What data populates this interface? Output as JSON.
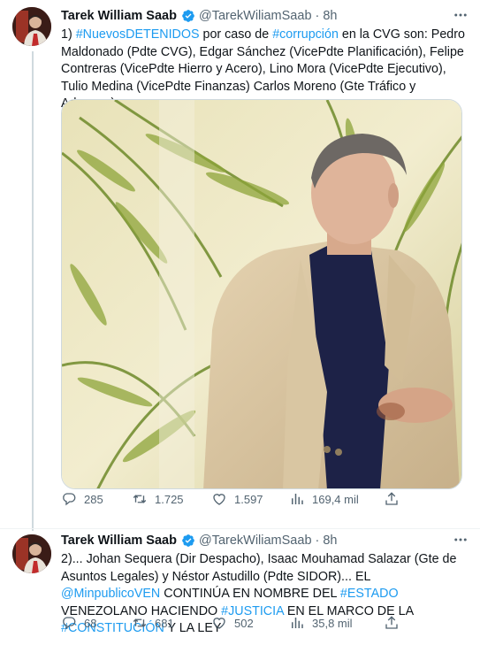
{
  "tweets": [
    {
      "author": {
        "name": "Tarek William Saab",
        "handle": "@TarekWiliamSaab",
        "verified": true
      },
      "time": "8h",
      "text_parts": [
        {
          "t": "1) ",
          "tag": false
        },
        {
          "t": "#NuevosDETENIDOS",
          "tag": true
        },
        {
          "t": " por caso de ",
          "tag": false
        },
        {
          "t": "#corrupción",
          "tag": true
        },
        {
          "t": " en la CVG son: Pedro Maldonado (Pdte CVG), Edgar Sánchez (VicePdte Planificación), Felipe Contreras (VicePdte Hierro y Acero), Lino Mora (VicePdte Ejecutivo), Tulio Medina (VicePdte Finanzas) Carlos Moreno (Gte Tráfico y Aduanas)",
          "tag": false
        }
      ],
      "stats": {
        "replies": "285",
        "retweets": "1.725",
        "likes": "1.597",
        "views": "169,4 mil"
      }
    },
    {
      "author": {
        "name": "Tarek William Saab",
        "handle": "@TarekWiliamSaab",
        "verified": true
      },
      "time": "8h",
      "text_parts": [
        {
          "t": "2)... Johan Sequera (Dir Despacho), Isaac Mouhamad Salazar (Gte de Asuntos Legales) y Néstor Astudillo (Pdte SIDOR)... EL ",
          "tag": false
        },
        {
          "t": "@MinpublicoVEN",
          "tag": true
        },
        {
          "t": " CONTINÚA EN NOMBRE DEL ",
          "tag": false
        },
        {
          "t": "#ESTADO",
          "tag": true
        },
        {
          "t": " VENEZOLANO HACIENDO ",
          "tag": false
        },
        {
          "t": "#JUSTICIA",
          "tag": true
        },
        {
          "t": " EN EL MARCO DE LA ",
          "tag": false
        },
        {
          "t": "#CONSTITUCIÓN",
          "tag": true
        },
        {
          "t": " Y LA LEY",
          "tag": false
        }
      ],
      "stats": {
        "replies": "68",
        "retweets": "681",
        "likes": "502",
        "views": "35,8 mil"
      }
    }
  ],
  "icons": {
    "verified": "verified-badge-icon",
    "more": "more-options-icon",
    "reply": "reply-icon",
    "retweet": "retweet-icon",
    "like": "like-icon",
    "views": "views-icon",
    "share": "share-icon"
  },
  "colors": {
    "link": "#1d9bf0",
    "text": "#0f1419",
    "muted": "#536471",
    "thread_line": "#cfd9de"
  }
}
